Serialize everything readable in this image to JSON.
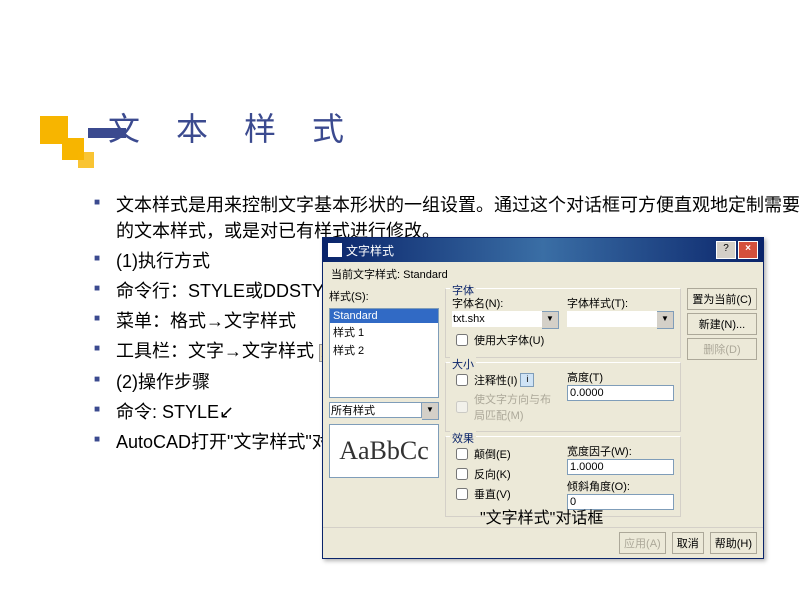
{
  "title": "文 本 样 式",
  "bullets": {
    "b1": "文本样式是用来控制文字基本形状的一组设置。通过这个对话框可方便直观地定制需要的文本样式，或是对已有样式进行修改。",
    "b2": "(1)执行方式",
    "b3": "命令行：STYLE或DDSTYLE",
    "b4": "菜单：格式→文字样式",
    "b5": "工具栏：文字→文字样式",
    "b6": "(2)操作步骤",
    "b7": "命令: STYLE↙",
    "b8": "AutoCAD打开\"文字样式\"对话框"
  },
  "caption": "\"文字样式\"对话框",
  "dialog": {
    "title": "文字样式",
    "current_label": "当前文字样式:",
    "current_value": "Standard",
    "styles_label": "样式(S):",
    "style_list": {
      "i0": "Standard",
      "i1": "样式 1",
      "i2": "样式 2"
    },
    "filter": "所有样式",
    "preview": "AaBbCc",
    "font_group": "字体",
    "font_name_label": "字体名(N):",
    "font_name": "txt.shx",
    "font_style_label": "字体样式(T):",
    "big_font": "使用大字体(U)",
    "size_group": "大小",
    "annotative": "注释性(I)",
    "match_orient": "使文字方向与布局匹配(M)",
    "height_label": "高度(T)",
    "height": "0.0000",
    "effects_group": "效果",
    "upside": "颠倒(E)",
    "backwards": "反向(K)",
    "vertical": "垂直(V)",
    "width_label": "宽度因子(W):",
    "width": "1.0000",
    "oblique_label": "倾斜角度(O):",
    "oblique": "0",
    "btn_current": "置为当前(C)",
    "btn_new": "新建(N)...",
    "btn_delete": "删除(D)",
    "btn_apply": "应用(A)",
    "btn_cancel": "取消",
    "btn_help": "帮助(H)"
  }
}
